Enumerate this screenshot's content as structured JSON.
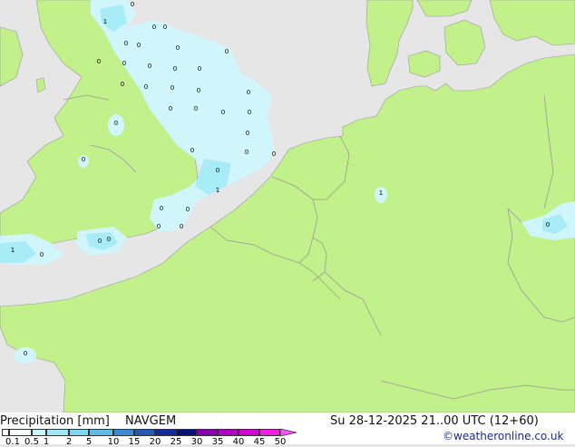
{
  "title": "Precipitation [mm]",
  "model": "NAVGEM",
  "valid_time": "Su 28-12-2025 21..00 UTC (12+60)",
  "credit": "©weatheronline.co.uk",
  "colors": {
    "sea": "#e6e6e6",
    "land": "#c2f08a",
    "precip_light": "#d0f6fb",
    "precip_medium": "#a8ecf7",
    "border": "#9a9a9a"
  },
  "legend": {
    "ticks": [
      "0.1",
      "0.5",
      "1",
      "2",
      "5",
      "10",
      "15",
      "20",
      "25",
      "30",
      "35",
      "40",
      "45",
      "50"
    ],
    "colors": [
      "#f5fdff",
      "#c8f3fb",
      "#9fe7f7",
      "#7dd7f2",
      "#5bbde8",
      "#3c8ad6",
      "#2458b8",
      "#14289a",
      "#0a107a",
      "#8800b0",
      "#b000c8",
      "#d400d0",
      "#f020e0",
      "#ff50ff"
    ]
  },
  "map_labels": [
    "0",
    "1",
    "0",
    "0",
    "0",
    "0",
    "0",
    "0",
    "0",
    "0",
    "0",
    "0",
    "0",
    "0",
    "0",
    "0",
    "0",
    "0",
    "0",
    "0",
    "0",
    "0",
    "0",
    "0",
    "0",
    "0",
    "0",
    "0",
    "0",
    "1",
    "0",
    "0",
    "0",
    "0",
    "1",
    "0",
    "1",
    "0",
    "0",
    "0",
    "0"
  ]
}
